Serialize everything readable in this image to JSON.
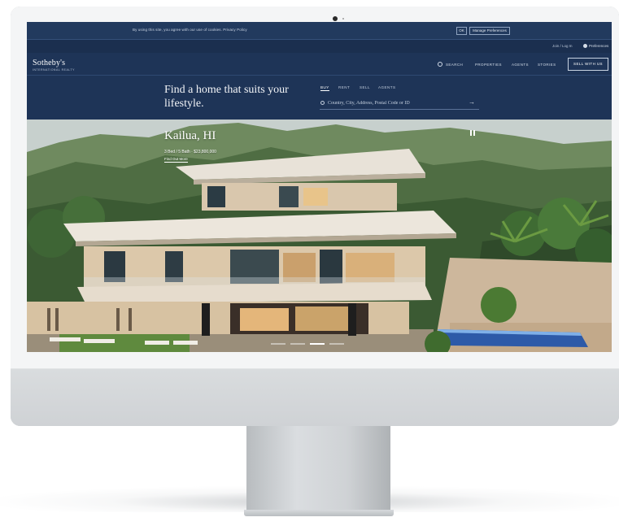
{
  "cookie_bar": {
    "text": "By using this site, you agree with our use of cookies. Privacy Policy",
    "ok_label": "OK",
    "manage_label": "Manage Preferences"
  },
  "utility": {
    "signin_label": "Join / Log In",
    "preferences_label": "Preferences"
  },
  "header": {
    "logo": "Sotheby's",
    "logo_sub": "INTERNATIONAL REALTY",
    "nav": [
      "SEARCH",
      "PROPERTIES",
      "AGENTS",
      "STORIES"
    ],
    "sell_label": "SELL WITH US"
  },
  "hero": {
    "headline": "Find a home that suits your lifestyle.",
    "search_tabs": [
      "BUY",
      "RENT",
      "SELL",
      "AGENTS"
    ],
    "search_placeholder": "Country, City, Address, Postal Code or ID",
    "arrow": "→"
  },
  "listing": {
    "city": "Kailua, HI",
    "meta": "3 Bed / 5 Bath · $23,800,000",
    "link": "Find Out More"
  },
  "colors": {
    "navy": "#1e3457",
    "accent_white": "#ffffff"
  },
  "icons": [
    "camera-icon",
    "search-icon",
    "pause-icon",
    "preferences-icon",
    "arrow-right-icon"
  ]
}
